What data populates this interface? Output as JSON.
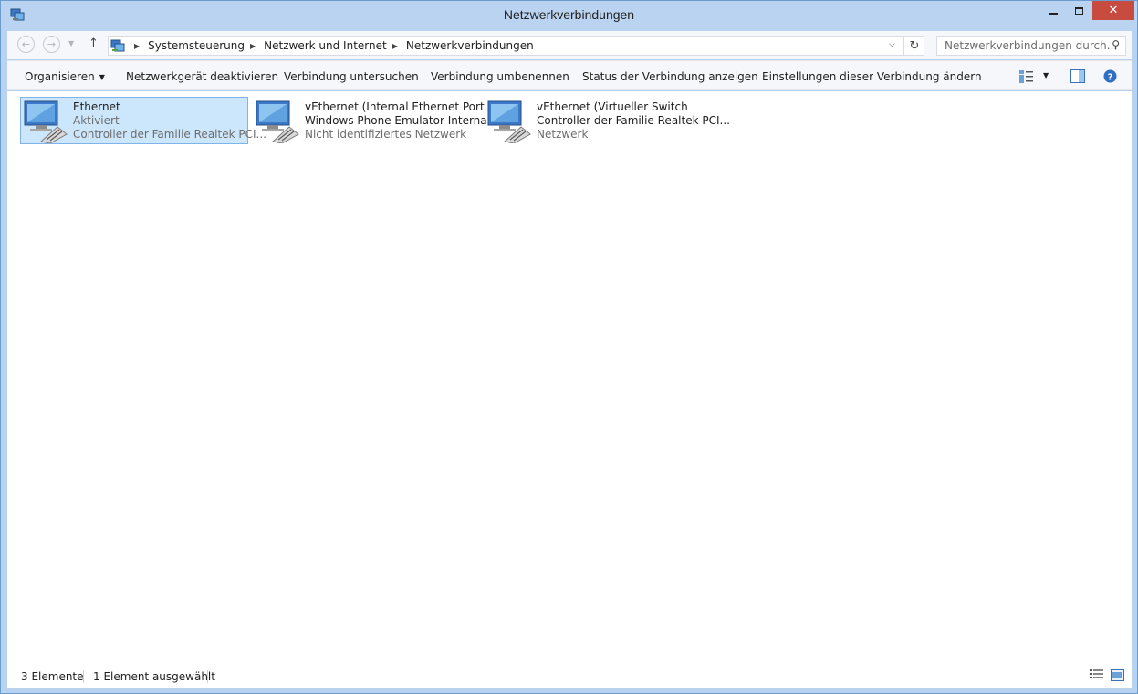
{
  "window": {
    "title": "Netzwerkverbindungen",
    "close_glyph": "✕"
  },
  "address": {
    "crumbs": [
      "Systemsteuerung",
      "Netzwerk und Internet",
      "Netzwerkverbindungen"
    ],
    "search_placeholder": "Netzwerkverbindungen durch..."
  },
  "toolbar": {
    "organize": "Organisieren",
    "disable": "Netzwerkgerät deaktivieren",
    "diagnose": "Verbindung untersuchen",
    "rename": "Verbindung umbenennen",
    "status": "Status der Verbindung anzeigen",
    "settings": "Einstellungen dieser Verbindung ändern"
  },
  "items": [
    {
      "line1": "Ethernet",
      "line2": "Aktiviert",
      "line3": "Controller der Familie Realtek PCI...",
      "selected": true
    },
    {
      "line1": "vEthernet (Internal Ethernet Port",
      "line2": "Windows Phone Emulator Interna...",
      "line3": "Nicht identifiziertes Netzwerk",
      "selected": false
    },
    {
      "line1": "vEthernet (Virtueller Switch",
      "line2": "Controller der Familie Realtek PCI...",
      "line3": "Netzwerk",
      "selected": false
    }
  ],
  "status": {
    "count": "3 Elemente",
    "selected": "1 Element ausgewählt"
  },
  "colors": {
    "accent": "#3875d7",
    "close": "#c74b3e",
    "selection": "#cce6fb"
  }
}
